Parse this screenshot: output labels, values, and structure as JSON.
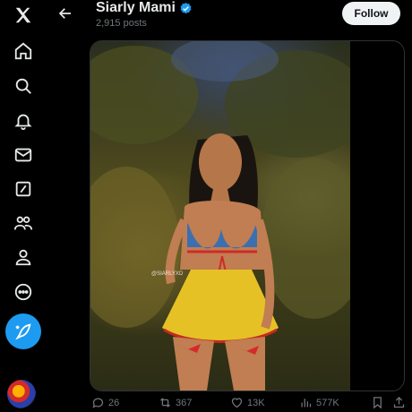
{
  "header": {
    "name": "Siarly Mami",
    "posts_count": "2,915 posts",
    "follow_label": "Follow"
  },
  "sidebar": {
    "items": [
      {
        "icon": "x-logo-icon"
      },
      {
        "icon": "home-icon"
      },
      {
        "icon": "search-icon"
      },
      {
        "icon": "notifications-bell-icon"
      },
      {
        "icon": "messages-envelope-icon"
      },
      {
        "icon": "grok-icon"
      },
      {
        "icon": "communities-icon"
      },
      {
        "icon": "profile-icon"
      },
      {
        "icon": "more-circle-icon"
      },
      {
        "icon": "compose-post-icon"
      }
    ]
  },
  "media": {
    "watermark": "@SIARLYXD"
  },
  "actions": {
    "replies": "26",
    "reposts": "367",
    "likes": "13K",
    "views": "577K"
  },
  "colors": {
    "accent": "#1d9bf0",
    "background": "#000000",
    "muted_text": "#71767b"
  }
}
